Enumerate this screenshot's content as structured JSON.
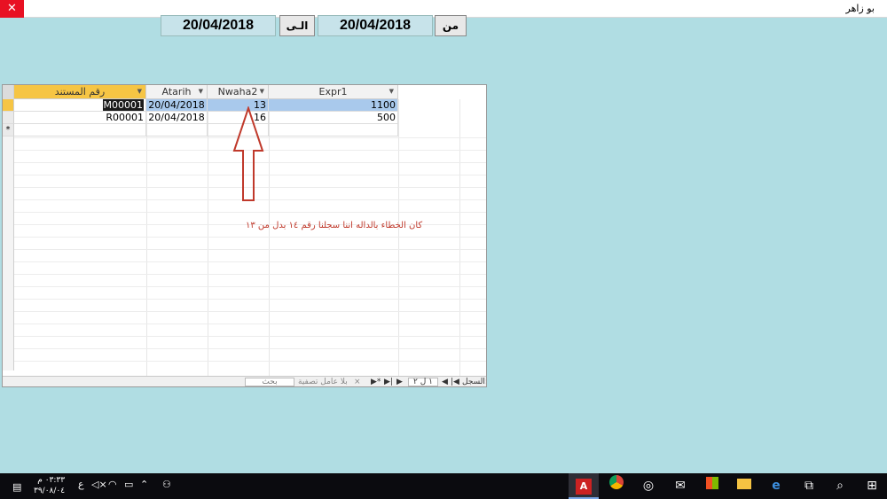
{
  "window": {
    "title": "بو زاهر",
    "close_glyph": "✕"
  },
  "header": {
    "from_label": "من",
    "from_date": "20/04/2018",
    "to_label": "الـى",
    "to_date": "20/04/2018"
  },
  "grid": {
    "columns": [
      {
        "label": "رقم المستند"
      },
      {
        "label": "Atarih"
      },
      {
        "label": "Nwaha2"
      },
      {
        "label": "Expr1"
      }
    ],
    "rows": [
      {
        "doc": "M00001",
        "date": "20/04/2018",
        "nwaha": "13",
        "expr": "1100"
      },
      {
        "doc": "R00001",
        "date": "20/04/2018",
        "nwaha": "16",
        "expr": "500"
      }
    ],
    "new_row_marker": "*"
  },
  "navbar": {
    "record_label": "السجل:",
    "position": "١ ل ٢",
    "filter_label": "بلا عامل تصفية",
    "search_placeholder": "بحث"
  },
  "annotation": "كان الخطاء بالداله اننا سجلنا رقم ١٤ بدل من ١٣",
  "taskbar": {
    "time": "٠٣:٣٣ م",
    "date": "٣٩/٠٨/٠٤",
    "lang": "ع"
  },
  "colors": {
    "annotation": "#c0392b",
    "selected_row": "#a9c9ec",
    "selected_cell": "#1b1b1b",
    "header_bg": "#f6c544"
  }
}
